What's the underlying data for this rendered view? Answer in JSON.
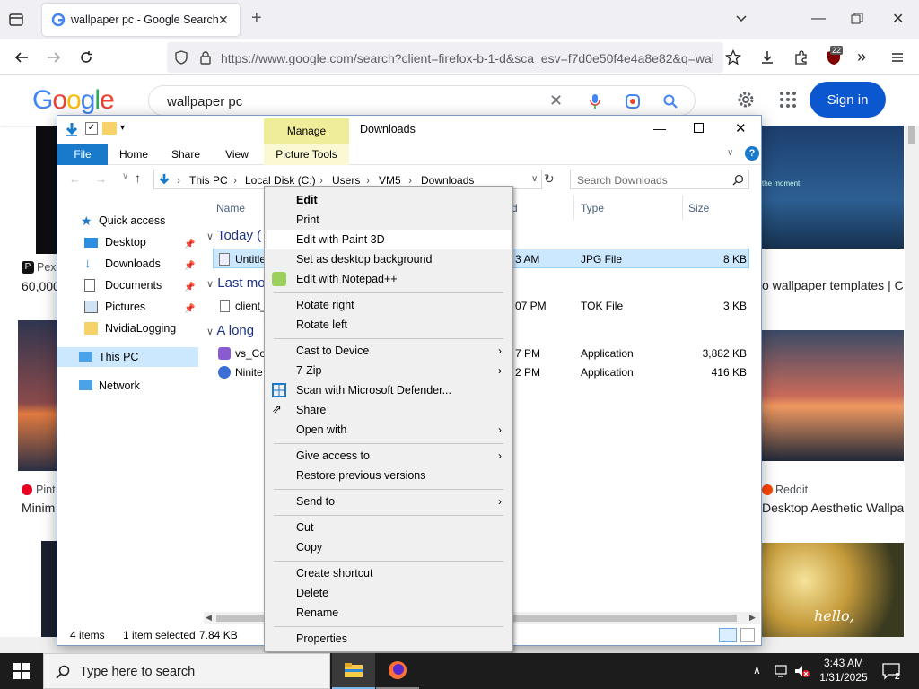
{
  "browser": {
    "tab_title": "wallpaper pc - Google Search",
    "url": "https://www.google.com/search?client=firefox-b-1-d&sca_esv=f7d0e50f4e4a8e82&q=wal",
    "extension_badge": "22"
  },
  "google": {
    "logo": "Google",
    "query": "wallpaper pc",
    "signin_label": "Sign in",
    "results": [
      {
        "source": "Pexels",
        "title": "60,000+"
      },
      {
        "source": "",
        "title": "o wallpaper templates | C"
      },
      {
        "source": "Pint",
        "title": "Minim"
      },
      {
        "source": "Reddit",
        "title": "Desktop Aesthetic Wallpa"
      }
    ],
    "hello_text": "hello,",
    "wall_text": "the moment"
  },
  "explorer": {
    "quick_tools": {
      "manage": "Manage",
      "picture_tools": "Picture Tools"
    },
    "title": "Downloads",
    "ribbon_tabs": [
      "File",
      "Home",
      "Share",
      "View"
    ],
    "breadcrumb": [
      "This PC",
      "Local Disk (C:)",
      "Users",
      "VM5",
      "Downloads"
    ],
    "search_placeholder": "Search Downloads",
    "nav": [
      {
        "label": "Quick access"
      },
      {
        "label": "Desktop"
      },
      {
        "label": "Downloads"
      },
      {
        "label": "Documents"
      },
      {
        "label": "Pictures"
      },
      {
        "label": "NvidiaLogging"
      },
      {
        "label": "This PC"
      },
      {
        "label": "Network"
      }
    ],
    "columns": {
      "name": "Name",
      "date": "d",
      "type": "Type",
      "size": "Size"
    },
    "groups": [
      "Today (",
      "Last mo",
      "A long"
    ],
    "files": [
      {
        "name": "Untitle",
        "date": "3 AM",
        "type": "JPG File",
        "size": "8 KB"
      },
      {
        "name": "client_",
        "date": "07 PM",
        "type": "TOK File",
        "size": "3 KB"
      },
      {
        "name": "vs_Co",
        "date": "7 PM",
        "type": "Application",
        "size": "3,882 KB"
      },
      {
        "name": "Ninite",
        "date": "2 PM",
        "type": "Application",
        "size": "416 KB"
      }
    ],
    "status": {
      "items": "4 items",
      "selected": "1 item selected",
      "size": "7.84 KB"
    }
  },
  "context_menu": {
    "items": [
      {
        "label": "Edit"
      },
      {
        "label": "Print"
      },
      {
        "label": "Edit with Paint 3D"
      },
      {
        "label": "Set as desktop background"
      },
      {
        "label": "Edit with Notepad++"
      },
      {
        "label": "Rotate right"
      },
      {
        "label": "Rotate left"
      },
      {
        "label": "Cast to Device"
      },
      {
        "label": "7-Zip"
      },
      {
        "label": "Scan with Microsoft Defender..."
      },
      {
        "label": "Share"
      },
      {
        "label": "Open with"
      },
      {
        "label": "Give access to"
      },
      {
        "label": "Restore previous versions"
      },
      {
        "label": "Send to"
      },
      {
        "label": "Cut"
      },
      {
        "label": "Copy"
      },
      {
        "label": "Create shortcut"
      },
      {
        "label": "Delete"
      },
      {
        "label": "Rename"
      },
      {
        "label": "Properties"
      }
    ]
  },
  "taskbar": {
    "search_placeholder": "Type here to search",
    "time": "3:43 AM",
    "date": "1/31/2025",
    "notification_count": "2"
  },
  "colors": {
    "google_blue": "#0b57d0",
    "explorer_file_tab": "#1979ca",
    "selection": "#cce8ff",
    "manage_tab": "#f0ed9a",
    "taskbar": "#1c1c1c"
  }
}
